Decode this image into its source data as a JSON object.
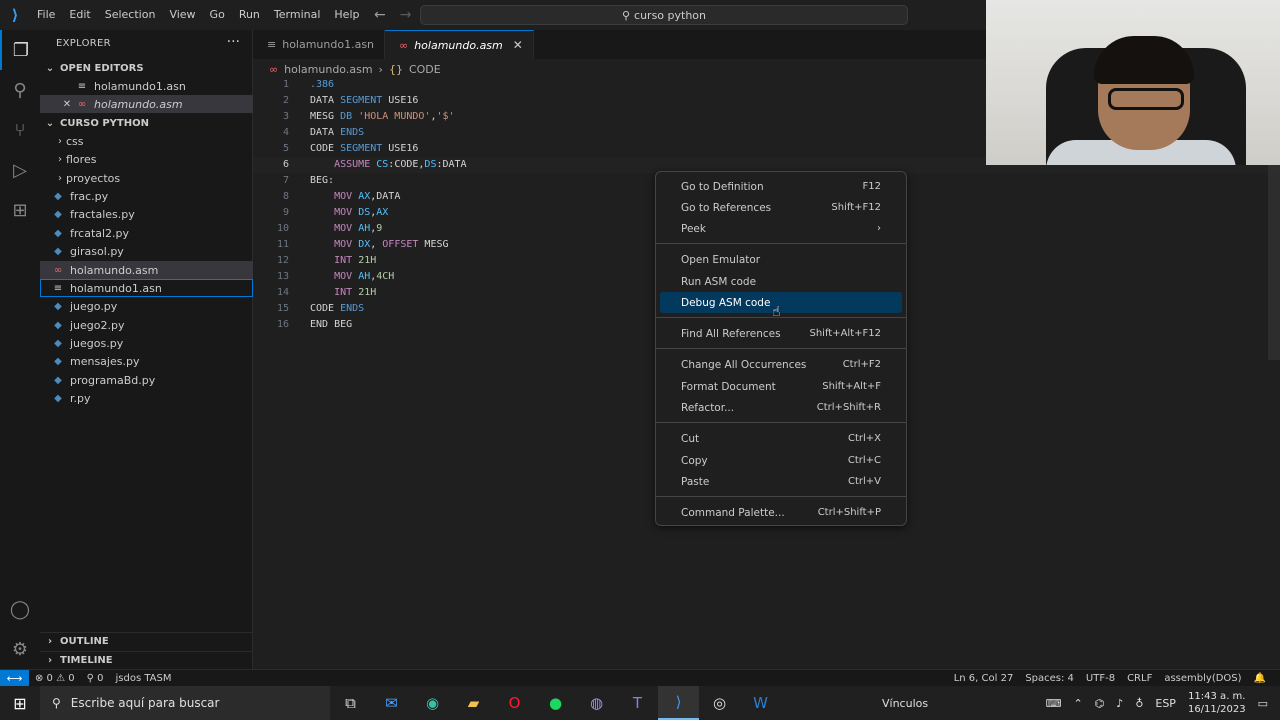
{
  "titlebar": {
    "menu": [
      "File",
      "Edit",
      "Selection",
      "View",
      "Go",
      "Run",
      "Terminal",
      "Help"
    ],
    "search": "curso python"
  },
  "sidebar": {
    "title": "EXPLORER",
    "open_editors_header": "OPEN EDITORS",
    "open_editors": [
      "holamundo1.asn",
      "holamundo.asm"
    ],
    "folder_header": "CURSO PYTHON",
    "folders": [
      "css",
      "flores",
      "proyectos"
    ],
    "files": [
      "frac.py",
      "fractales.py",
      "frcatal2.py",
      "girasol.py",
      "holamundo.asm",
      "holamundo1.asn",
      "juego.py",
      "juego2.py",
      "juegos.py",
      "mensajes.py",
      "programaBd.py",
      "r.py"
    ],
    "outline": "OUTLINE",
    "timeline": "TIMELINE"
  },
  "tabs": [
    "holamundo1.asn",
    "holamundo.asm"
  ],
  "breadcrumb": {
    "file": "holamundo.asm",
    "symbol": "CODE"
  },
  "code": {
    "line_numbers": [
      "1",
      "2",
      "3",
      "4",
      "5",
      "6",
      "7",
      "8",
      "9",
      "10",
      "11",
      "12",
      "13",
      "14",
      "15",
      "16"
    ]
  },
  "context_menu": {
    "items": [
      {
        "label": "Go to Definition",
        "key": "F12"
      },
      {
        "label": "Go to References",
        "key": "Shift+F12"
      },
      {
        "label": "Peek",
        "key": ""
      },
      {
        "label": "Open Emulator",
        "key": ""
      },
      {
        "label": "Run ASM code",
        "key": ""
      },
      {
        "label": "Debug ASM code",
        "key": ""
      },
      {
        "label": "Find All References",
        "key": "Shift+Alt+F12"
      },
      {
        "label": "Change All Occurrences",
        "key": "Ctrl+F2"
      },
      {
        "label": "Format Document",
        "key": "Shift+Alt+F"
      },
      {
        "label": "Refactor...",
        "key": "Ctrl+Shift+R"
      },
      {
        "label": "Cut",
        "key": "Ctrl+X"
      },
      {
        "label": "Copy",
        "key": "Ctrl+C"
      },
      {
        "label": "Paste",
        "key": "Ctrl+V"
      },
      {
        "label": "Command Palette...",
        "key": "Ctrl+Shift+P"
      }
    ]
  },
  "statusbar": {
    "problems": "⊗ 0 ⚠ 0",
    "ports": "⚲ 0",
    "jsdos": "jsdos TASM",
    "position": "Ln 6, Col 27",
    "spaces": "Spaces: 4",
    "encoding": "UTF-8",
    "eol": "CRLF",
    "language": "assembly(DOS)"
  },
  "taskbar": {
    "search_placeholder": "Escribe aquí para buscar",
    "links_label": "Vínculos",
    "time": "11:43 a. m.",
    "date": "16/11/2023"
  },
  "colors": {
    "accent": "#0078d4",
    "menu_highlight": "#04395e"
  }
}
